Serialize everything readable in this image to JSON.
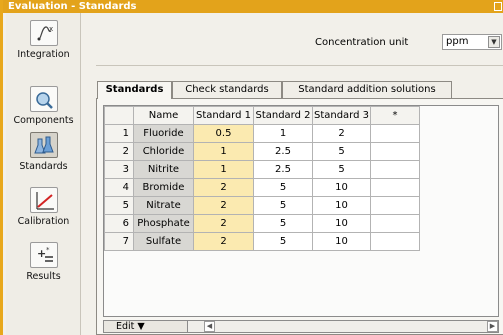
{
  "window": {
    "title": "Evaluation - Standards"
  },
  "sidebar": {
    "items": [
      {
        "label": "Integration",
        "icon": "integration-icon"
      },
      {
        "label": "Components",
        "icon": "components-icon"
      },
      {
        "label": "Standards",
        "icon": "standards-flask-icon",
        "selected": true
      },
      {
        "label": "Calibration",
        "icon": "calibration-chart-icon"
      },
      {
        "label": "Results",
        "icon": "results-icon"
      }
    ]
  },
  "concentration": {
    "label": "Concentration unit",
    "value": "ppm"
  },
  "tabs": [
    {
      "label": "Standards",
      "active": true
    },
    {
      "label": "Check standards",
      "active": false
    },
    {
      "label": "Standard addition solutions",
      "active": false
    }
  ],
  "table": {
    "headers": [
      "",
      "Name",
      "Standard 1",
      "Standard 2",
      "Standard 3",
      "*"
    ],
    "rows": [
      {
        "num": "1",
        "name": "Fluoride",
        "s1": "0.5",
        "s2": "1",
        "s3": "2"
      },
      {
        "num": "2",
        "name": "Chloride",
        "s1": "1",
        "s2": "2.5",
        "s3": "5"
      },
      {
        "num": "3",
        "name": "Nitrite",
        "s1": "1",
        "s2": "2.5",
        "s3": "5"
      },
      {
        "num": "4",
        "name": "Bromide",
        "s1": "2",
        "s2": "5",
        "s3": "10"
      },
      {
        "num": "5",
        "name": "Nitrate",
        "s1": "2",
        "s2": "5",
        "s3": "10"
      },
      {
        "num": "6",
        "name": "Phosphate",
        "s1": "2",
        "s2": "5",
        "s3": "10"
      },
      {
        "num": "7",
        "name": "Sulfate",
        "s1": "2",
        "s2": "5",
        "s3": "10"
      }
    ]
  },
  "edit_button": {
    "label": "Edit ▼"
  },
  "colors": {
    "title_bar": "#e3a31b",
    "standard1_highlight": "#fbeab0",
    "name_column": "#d8d7d3"
  }
}
